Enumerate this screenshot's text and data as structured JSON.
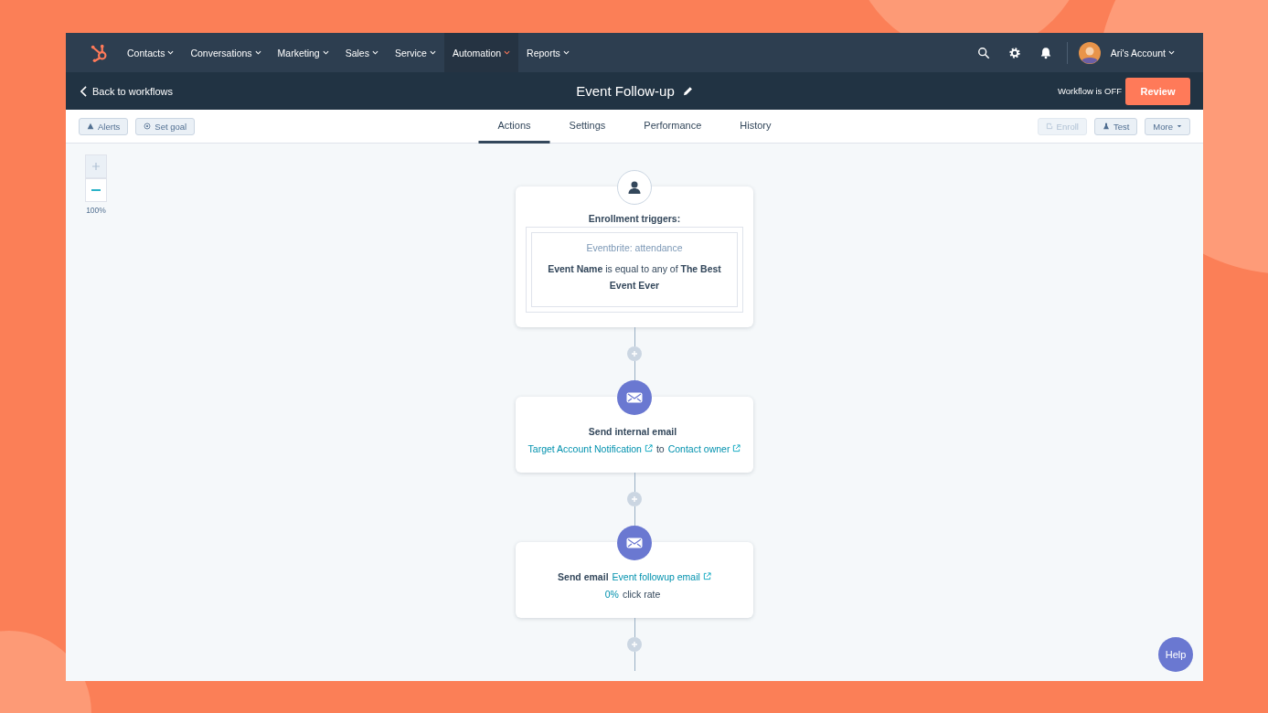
{
  "nav": {
    "items": [
      {
        "label": "Contacts",
        "selected": false
      },
      {
        "label": "Conversations",
        "selected": false
      },
      {
        "label": "Marketing",
        "selected": false
      },
      {
        "label": "Sales",
        "selected": false
      },
      {
        "label": "Service",
        "selected": false
      },
      {
        "label": "Automation",
        "selected": true
      },
      {
        "label": "Reports",
        "selected": false
      }
    ],
    "account": "Ari's Account"
  },
  "header": {
    "back": "Back to workflows",
    "title": "Event Follow-up",
    "status": "Workflow is OFF",
    "review": "Review"
  },
  "toolbar": {
    "left": [
      "Alerts",
      "Set goal"
    ],
    "tabs": [
      {
        "label": "Actions",
        "selected": true
      },
      {
        "label": "Settings",
        "selected": false
      },
      {
        "label": "Performance",
        "selected": false
      },
      {
        "label": "History",
        "selected": false
      }
    ],
    "right": [
      {
        "kind": "enroll",
        "label": "Enroll",
        "disabled": true
      },
      {
        "kind": "test",
        "label": "Test",
        "disabled": false
      },
      {
        "kind": "more",
        "label": "More",
        "disabled": false
      }
    ]
  },
  "zoom": "100%",
  "trigger": {
    "title": "Enrollment triggers:",
    "source": "Eventbrite: attendance",
    "condition": "**Event Name** is equal to any of **The Best Event Ever**"
  },
  "actions": [
    {
      "lines": [
        [
          {
            "kind": "strong",
            "text": "Send internal email"
          }
        ],
        [
          {
            "kind": "external_link",
            "text": "Target Account Notification"
          },
          {
            "kind": "plain",
            "text": "to"
          },
          {
            "kind": "external_link",
            "text": "Contact owner"
          }
        ]
      ]
    },
    {
      "lines": [
        [
          {
            "kind": "strong",
            "text": "Send email"
          },
          {
            "kind": "external_link",
            "text": "Event followup email"
          }
        ],
        [
          {
            "kind": "link",
            "text": "0%"
          },
          {
            "kind": "plain",
            "text": "click rate"
          }
        ]
      ]
    }
  ],
  "help": "Help"
}
